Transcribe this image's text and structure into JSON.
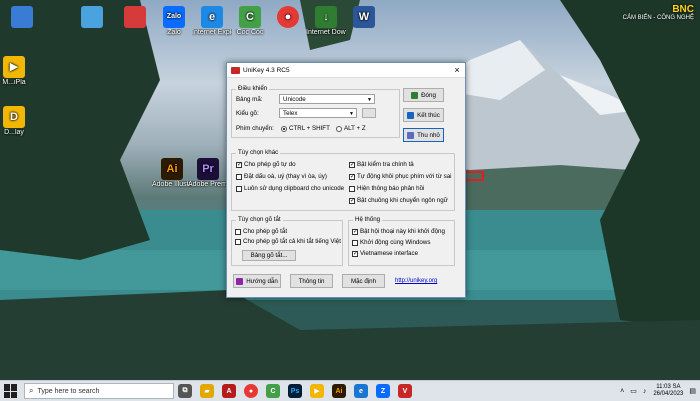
{
  "desktop": {
    "icons": [
      {
        "name": "desktop-icon-1",
        "label": "",
        "color": "#3a7bd5",
        "glyph": ""
      },
      {
        "name": "desktop-icon-2",
        "label": "",
        "color": "#4aa3df",
        "glyph": ""
      },
      {
        "name": "desktop-icon-3",
        "label": "",
        "color": "#d63b3b",
        "glyph": ""
      },
      {
        "name": "desktop-icon-zalo",
        "label": "Zalo",
        "color": "#0a6cff",
        "glyph": "Zalo"
      },
      {
        "name": "desktop-icon-ie",
        "label": "Internet Explorer",
        "color": "#1e88e5",
        "glyph": "e"
      },
      {
        "name": "desktop-icon-coccoc",
        "label": "Cốc Cốc",
        "color": "#43a047",
        "glyph": "C"
      },
      {
        "name": "desktop-icon-chrome",
        "label": "",
        "color": "#e53935",
        "glyph": "●"
      },
      {
        "name": "desktop-icon-internet-download",
        "label": "Internet Download...",
        "color": "#2e7d32",
        "glyph": "↓"
      },
      {
        "name": "desktop-icon-word",
        "label": "",
        "color": "#2b579a",
        "glyph": "W"
      },
      {
        "name": "desktop-icon-multiplayer",
        "label": "M...iPla",
        "color": "#f2b705",
        "glyph": "▶"
      },
      {
        "name": "desktop-icon-d",
        "label": "D...lay",
        "color": "#f2b705",
        "glyph": "D"
      },
      {
        "name": "desktop-icon-illustrator",
        "label": "Adobe Illustrat...",
        "color": "#2d1b00",
        "glyph": "Ai"
      },
      {
        "name": "desktop-icon-premiere",
        "label": "Adobe Premiere P...",
        "color": "#1b0f38",
        "glyph": "Pr"
      }
    ],
    "brand": {
      "name": "BNC",
      "tagline": "CẢM BIẾN - CÔNG NGHỆ"
    }
  },
  "window": {
    "title": "UniKey 4.3 RC5",
    "close_glyph": "×",
    "controls": {
      "legend": "Điều khiển",
      "charset_label": "Bảng mã:",
      "charset_value": "Unicode",
      "method_label": "Kiểu gõ:",
      "method_value": "Telex",
      "hotkey_label": "Phím chuyển:",
      "hotkey_opt1": "CTRL + SHIFT",
      "hotkey_opt2": "ALT + Z"
    },
    "buttons": {
      "close": "Đóng",
      "exit": "Kết thúc",
      "minimize": "Thu nhỏ"
    },
    "other_options": {
      "legend": "Tùy chọn khác",
      "left": [
        {
          "label": "Cho phép gõ tự do",
          "checked": true
        },
        {
          "label": "Đặt dấu oà, uý (thay vì òa, úy)",
          "checked": false
        },
        {
          "label": "Luôn sử dụng clipboard cho unicode",
          "checked": false
        }
      ],
      "right": [
        {
          "label": "Bật kiểm tra chính tả",
          "checked": true
        },
        {
          "label": "Tự động khôi phục phím với từ sai",
          "checked": true
        },
        {
          "label": "Hiện thông báo phản hồi",
          "checked": false
        },
        {
          "label": "Bật chuông khi chuyển ngôn ngữ",
          "checked": true
        }
      ]
    },
    "shorthand": {
      "legend": "Tùy chọn gõ tắt",
      "items": [
        {
          "label": "Cho phép gõ tắt",
          "checked": false
        },
        {
          "label": "Cho phép gõ tắt cả khi tắt tiếng Việt",
          "checked": false
        }
      ],
      "table_button": "Bảng gõ tắt..."
    },
    "system": {
      "legend": "Hệ thống",
      "items": [
        {
          "label": "Bật hội thoại này khi khởi động",
          "checked": true
        },
        {
          "label": "Khởi động cùng Windows",
          "checked": false
        },
        {
          "label": "Vietnamese interface",
          "checked": true
        }
      ]
    },
    "footer": {
      "help": "Hướng dẫn",
      "info": "Thông tin",
      "default": "Mặc định",
      "link": "http://unikey.org"
    }
  },
  "taskbar": {
    "search_placeholder": "Type here to search",
    "time": "11:03 SA",
    "date": "26/04/2023",
    "apps": [
      {
        "name": "task-view-icon",
        "glyph": "⧉",
        "color": "#555"
      },
      {
        "name": "file-explorer-taskbar-icon",
        "glyph": "▰",
        "color": "#e0a800"
      },
      {
        "name": "cad-taskbar-icon",
        "glyph": "A",
        "color": "#b71c1c"
      },
      {
        "name": "chrome-taskbar-icon",
        "glyph": "●",
        "color": "#e53935"
      },
      {
        "name": "coccoc-taskbar-icon",
        "glyph": "C",
        "color": "#43a047"
      },
      {
        "name": "photoshop-taskbar-icon",
        "glyph": "Ps",
        "color": "#001e36"
      },
      {
        "name": "media-taskbar-icon",
        "glyph": "▶",
        "color": "#f2b705"
      },
      {
        "name": "illustrator-taskbar-icon",
        "glyph": "Ai",
        "color": "#2d1b00"
      },
      {
        "name": "edge-taskbar-icon",
        "glyph": "e",
        "color": "#1976d2"
      },
      {
        "name": "zalo-taskbar-icon",
        "glyph": "Z",
        "color": "#0a6cff"
      },
      {
        "name": "unikey-taskbar-icon",
        "glyph": "V",
        "color": "#c62828"
      }
    ]
  }
}
